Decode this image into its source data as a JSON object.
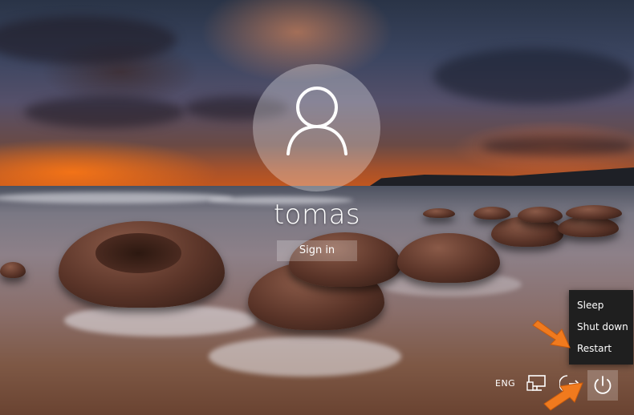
{
  "user": {
    "name": "tomas"
  },
  "signin": {
    "label": "Sign in"
  },
  "power_menu": {
    "items": [
      "Sleep",
      "Shut down",
      "Restart"
    ]
  },
  "system_tray": {
    "language": "ENG",
    "icons": [
      "network-icon",
      "accessibility-icon",
      "power-icon"
    ]
  },
  "annotations": {
    "arrow_color": "#f07a1e"
  },
  "background": {
    "scene": "beach-boulders-sunset"
  }
}
